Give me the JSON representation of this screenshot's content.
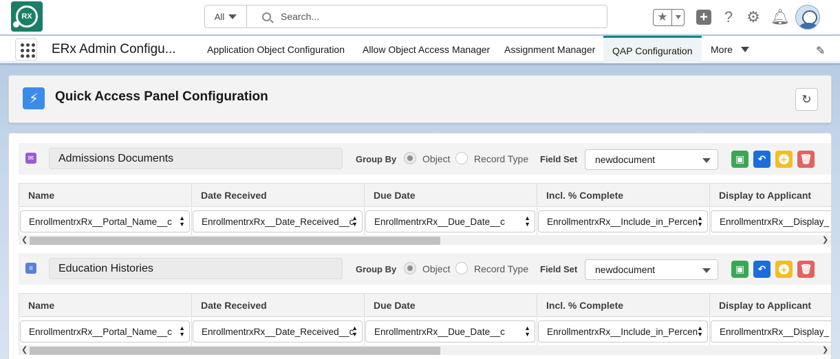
{
  "header": {
    "logo_text": "RX",
    "search_scope": "All",
    "search_placeholder": "Search..."
  },
  "context": {
    "app_name": "ERx Admin Configu...",
    "tabs": [
      {
        "label": "Application Object Configuration"
      },
      {
        "label": "Allow Object Access Manager"
      },
      {
        "label": "Assignment Manager"
      },
      {
        "label": "QAP Configuration"
      },
      {
        "label": "More"
      }
    ]
  },
  "page": {
    "title": "Quick Access Panel Configuration"
  },
  "sections": [
    {
      "name": "Admissions Documents",
      "icon_color": "#9b5bd4",
      "group_by_label": "Group By",
      "option_object": "Object",
      "option_record_type": "Record Type",
      "field_set_label": "Field Set",
      "field_set_value": "newdocument",
      "columns": [
        "Name",
        "Date Received",
        "Due Date",
        "Incl. % Complete",
        "Display to Applicant"
      ],
      "values": [
        "EnrollmentrxRx__Portal_Name__c",
        "EnrollmentrxRx__Date_Received__c",
        "EnrollmentrxRx__Due_Date__c",
        "EnrollmentrxRx__Include_in_Percen",
        "EnrollmentrxRx__Display_"
      ]
    },
    {
      "name": "Education Histories",
      "icon_color": "#5a7fd6",
      "group_by_label": "Group By",
      "option_object": "Object",
      "option_record_type": "Record Type",
      "field_set_label": "Field Set",
      "field_set_value": "newdocument",
      "columns": [
        "Name",
        "Date Received",
        "Due Date",
        "Incl. % Complete",
        "Display to Applicant"
      ],
      "values": [
        "EnrollmentrxRx__Portal_Name__c",
        "EnrollmentrxRx__Date_Received__c",
        "EnrollmentrxRx__Due_Date__c",
        "EnrollmentrxRx__Include_in_Percen",
        "EnrollmentrxRx__Display_"
      ]
    }
  ]
}
